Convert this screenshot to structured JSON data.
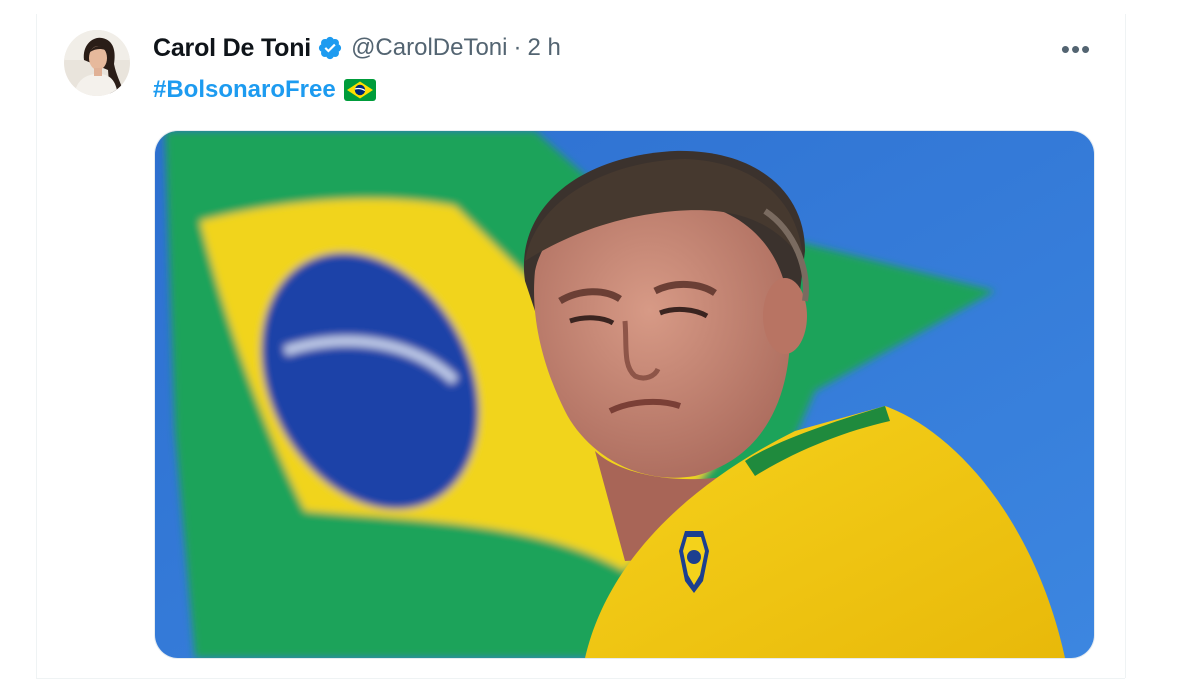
{
  "tweet": {
    "author": {
      "display_name": "Carol De Toni",
      "handle": "@CarolDeToni",
      "verified": true
    },
    "separator": "·",
    "timestamp": "2 h",
    "more_label": "•••",
    "text": {
      "hashtag": "#BolsonaroFree",
      "emoji": "brazil-flag-emoji"
    },
    "media": {
      "type": "photo",
      "description_icon": "photo"
    }
  },
  "colors": {
    "primary_text": "#0f1419",
    "secondary_text": "#536471",
    "link": "#1d9bf0",
    "verified_badge": "#1d9bf0",
    "border": "#eff3f4"
  }
}
